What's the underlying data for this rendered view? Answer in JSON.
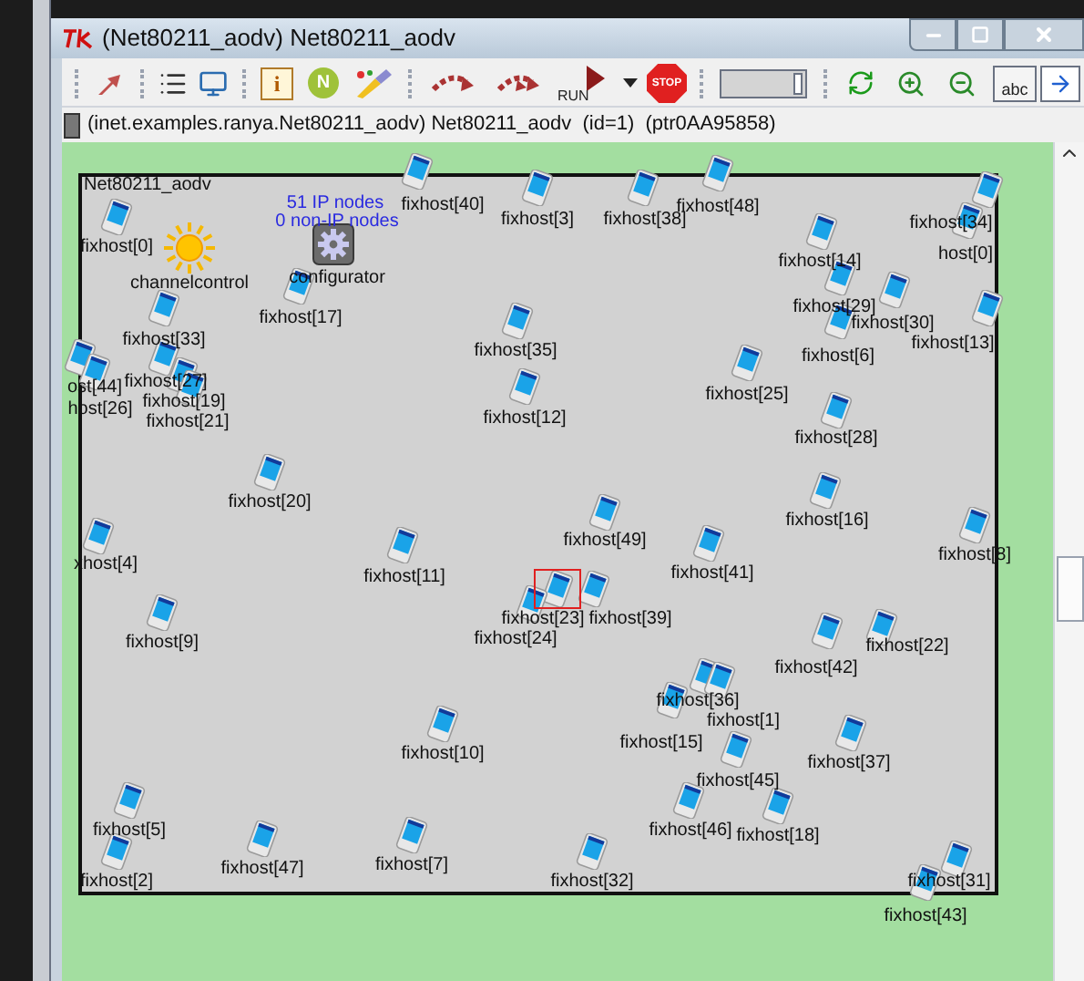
{
  "window": {
    "title": "(Net80211_aodv) Net80211_aodv"
  },
  "toolbar": [
    {
      "kind": "grip"
    },
    {
      "kind": "up"
    },
    {
      "kind": "grip"
    },
    {
      "kind": "list"
    },
    {
      "kind": "screen"
    },
    {
      "kind": "grip"
    },
    {
      "kind": "info",
      "label": "i"
    },
    {
      "kind": "n",
      "label": "N"
    },
    {
      "kind": "brush"
    },
    {
      "kind": "grip"
    },
    {
      "kind": "step"
    },
    {
      "kind": "fast"
    },
    {
      "kind": "run",
      "label": "RUN"
    },
    {
      "kind": "dropdown"
    },
    {
      "kind": "stop",
      "label": "STOP"
    },
    {
      "kind": "grip"
    },
    {
      "kind": "slider",
      "level": 0.92
    },
    {
      "kind": "grip"
    },
    {
      "kind": "refresh"
    },
    {
      "kind": "zoomin"
    },
    {
      "kind": "zoomout"
    },
    {
      "kind": "abc",
      "label": "abc"
    },
    {
      "kind": "arrow"
    }
  ],
  "info_bar": "(inet.examples.ranya.Net80211_aodv) Net80211_aodv  (id=1)  (ptr0AA95858)",
  "network": {
    "name": "Net80211_aodv",
    "stats": [
      "51 IP nodes",
      "0 non-IP nodes"
    ],
    "nodes": [
      {
        "kind": "host",
        "label": "fixhost[40]",
        "selected": false
      },
      {
        "kind": "host",
        "label": "fixhost[3]",
        "selected": false
      },
      {
        "kind": "host",
        "label": "fixhost[38]",
        "selected": false
      },
      {
        "kind": "host",
        "label": "fixhost[48]",
        "selected": false
      },
      {
        "kind": "host",
        "label": "fixhost[34]",
        "selected": false
      },
      {
        "kind": "host",
        "label": "fixhost[0]",
        "selected": false
      },
      {
        "kind": "host",
        "label": "fixhost[14]",
        "selected": false
      },
      {
        "kind": "host",
        "label": "host[0]",
        "selected": false
      },
      {
        "kind": "sun",
        "label": "channelcontrol",
        "selected": false
      },
      {
        "kind": "gear",
        "label": "configurator",
        "selected": false
      },
      {
        "kind": "host",
        "label": "fixhost[17]",
        "selected": false
      },
      {
        "kind": "host",
        "label": "fixhost[29]",
        "selected": false
      },
      {
        "kind": "host",
        "label": "fixhost[30]",
        "selected": false
      },
      {
        "kind": "host",
        "label": "fixhost[33]",
        "selected": false
      },
      {
        "kind": "host",
        "label": "fixhost[35]",
        "selected": false
      },
      {
        "kind": "host",
        "label": "fixhost[6]",
        "selected": false
      },
      {
        "kind": "host",
        "label": "fixhost[13]",
        "selected": false
      },
      {
        "kind": "host",
        "label": "ost[44]",
        "selected": false
      },
      {
        "kind": "host",
        "label": "fixhost[27]",
        "selected": false
      },
      {
        "kind": "host",
        "label": "fixhost[25]",
        "selected": false
      },
      {
        "kind": "host",
        "label": "host[26]",
        "selected": false
      },
      {
        "kind": "host",
        "label": "fixhost[19]",
        "selected": false
      },
      {
        "kind": "host",
        "label": "fixhost[21]",
        "selected": false
      },
      {
        "kind": "host",
        "label": "fixhost[12]",
        "selected": false
      },
      {
        "kind": "host",
        "label": "fixhost[28]",
        "selected": false
      },
      {
        "kind": "host",
        "label": "fixhost[20]",
        "selected": false
      },
      {
        "kind": "host",
        "label": "fixhost[16]",
        "selected": false
      },
      {
        "kind": "host",
        "label": "xhost[4]",
        "selected": false
      },
      {
        "kind": "host",
        "label": "fixhost[11]",
        "selected": false
      },
      {
        "kind": "host",
        "label": "fixhost[49]",
        "selected": false
      },
      {
        "kind": "host",
        "label": "fixhost[41]",
        "selected": false
      },
      {
        "kind": "host",
        "label": "fixhost[8]",
        "selected": false
      },
      {
        "kind": "host",
        "label": "fixhost[23]",
        "selected": true
      },
      {
        "kind": "host",
        "label": "fixhost[39]",
        "selected": false
      },
      {
        "kind": "host",
        "label": "fixhost[9]",
        "selected": false
      },
      {
        "kind": "host",
        "label": "fixhost[24]",
        "selected": false
      },
      {
        "kind": "host",
        "label": "fixhost[22]",
        "selected": false
      },
      {
        "kind": "host",
        "label": "fixhost[42]",
        "selected": false
      },
      {
        "kind": "host",
        "label": "fixhost[36]",
        "selected": false
      },
      {
        "kind": "host",
        "label": "fixhost[1]",
        "selected": false
      },
      {
        "kind": "host",
        "label": "fixhost[10]",
        "selected": false
      },
      {
        "kind": "host",
        "label": "fixhost[15]",
        "selected": false
      },
      {
        "kind": "host",
        "label": "fixhost[37]",
        "selected": false
      },
      {
        "kind": "host",
        "label": "fixhost[45]",
        "selected": false
      },
      {
        "kind": "host",
        "label": "fixhost[5]",
        "selected": false
      },
      {
        "kind": "host",
        "label": "fixhost[46]",
        "selected": false
      },
      {
        "kind": "host",
        "label": "fixhost[18]",
        "selected": false
      },
      {
        "kind": "host",
        "label": "fixhost[47]",
        "selected": false
      },
      {
        "kind": "host",
        "label": "fixhost[7]",
        "selected": false
      },
      {
        "kind": "host",
        "label": "fixhost[2]",
        "selected": false
      },
      {
        "kind": "host",
        "label": "fixhost[32]",
        "selected": false
      },
      {
        "kind": "host",
        "label": "fixhost[31]",
        "selected": false
      },
      {
        "kind": "host",
        "label": "fixhost[43]",
        "selected": false
      }
    ]
  }
}
